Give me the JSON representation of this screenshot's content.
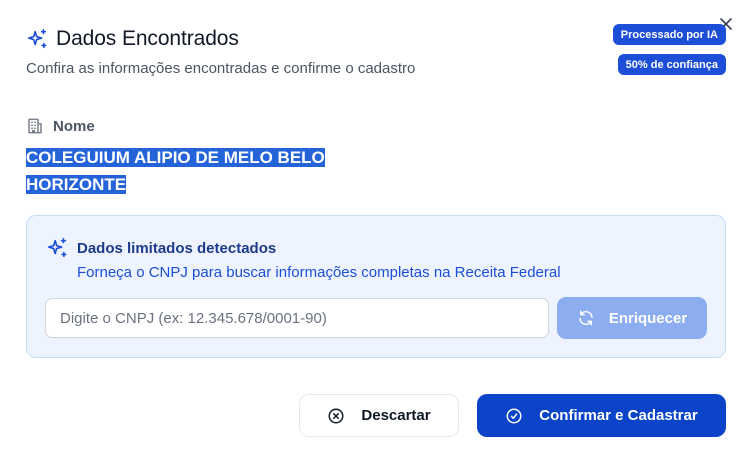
{
  "dialog": {
    "title": "Dados Encontrados",
    "subtitle": "Confira as informações encontradas e confirme o cadastro",
    "close_icon": "close-icon",
    "title_icon": "sparkles-icon"
  },
  "badges": {
    "ai": "Processado por IA",
    "confidence": "50% de confiança"
  },
  "field": {
    "label": "Nome",
    "icon": "building-icon",
    "value_line1": "COLEGUIUM ALIPIO DE MELO BELO",
    "value_line2": "HORIZONTE"
  },
  "notice": {
    "icon": "sparkles-icon",
    "title": "Dados limitados detectados",
    "description": "Forneça o CNPJ para buscar informações completas na Receita Federal"
  },
  "cnpj": {
    "placeholder": "Digite o CNPJ (ex: 12.345.678/0001-90)",
    "value": ""
  },
  "buttons": {
    "enrich_label": "Enriquecer",
    "enrich_icon": "refresh-icon",
    "discard_label": "Descartar",
    "discard_icon": "x-circle-icon",
    "confirm_label": "Confirmar e Cadastrar",
    "confirm_icon": "check-circle-icon"
  },
  "colors": {
    "primary": "#0b44c8",
    "badge": "#1d4ed8",
    "highlight": "#2563d8",
    "notice_bg": "#eef4ff",
    "enrich_disabled": "#8caef0"
  }
}
